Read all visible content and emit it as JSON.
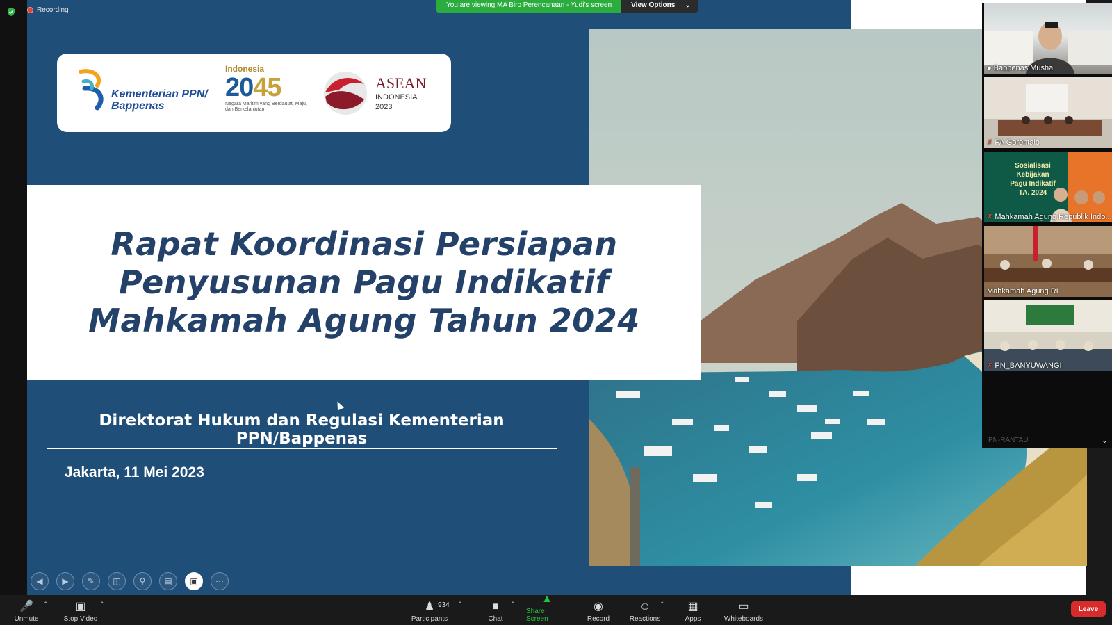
{
  "recording": {
    "label": "Recording",
    "indicator_color": "#e0473b"
  },
  "banner": {
    "viewing_text": "You are viewing MA Biro Perencanaan - Yudi's screen",
    "view_options": "View Options"
  },
  "slide": {
    "logos": {
      "kementerian": [
        "Kementerian PPN/",
        "Bappenas"
      ],
      "indonesia_label": "Indonesia",
      "indonesia_year_a": "20",
      "indonesia_year_b": "45",
      "indonesia_sub": "Negara Maritim yang Berdaulat, Maju, dan Berkelanjutan",
      "asean_title": "ASEAN",
      "asean_country": "INDONESIA",
      "asean_year": "2023"
    },
    "title_lines": [
      "Rapat Koordinasi Persiapan",
      "Penyusunan Pagu Indikatif",
      "Mahkamah Agung Tahun 2024"
    ],
    "department": "Direktorat Hukum dan Regulasi Kementerian PPN/Bappenas",
    "date": "Jakarta, 11 Mei 2023",
    "background_color": "#1f4e79",
    "title_color": "#24416a"
  },
  "participants": {
    "tiles": [
      {
        "name": "Bappenas Musha",
        "muted": false
      },
      {
        "name": "PA Gorontalo",
        "muted": true
      },
      {
        "name": "Mahkamah Agung Republik Indo...",
        "muted": true,
        "banner": [
          "Sosialisasi Kebijakan",
          "Pagu Indikatif",
          "TA. 2024"
        ]
      },
      {
        "name": "Mahkamah Agung RI",
        "muted": false
      },
      {
        "name": "PN_BANYUWANGI",
        "muted": true
      }
    ],
    "more_label": "PN-RANTAU"
  },
  "toolbar": {
    "unmute": "Unmute",
    "stop_video": "Stop Video",
    "participants": "Participants",
    "participant_count": "934",
    "chat": "Chat",
    "share_screen": "Share Screen",
    "record": "Record",
    "reactions": "Reactions",
    "apps": "Apps",
    "whiteboards": "Whiteboards",
    "leave": "Leave",
    "accent_green": "#25c43f",
    "leave_color": "#d82b2b"
  }
}
